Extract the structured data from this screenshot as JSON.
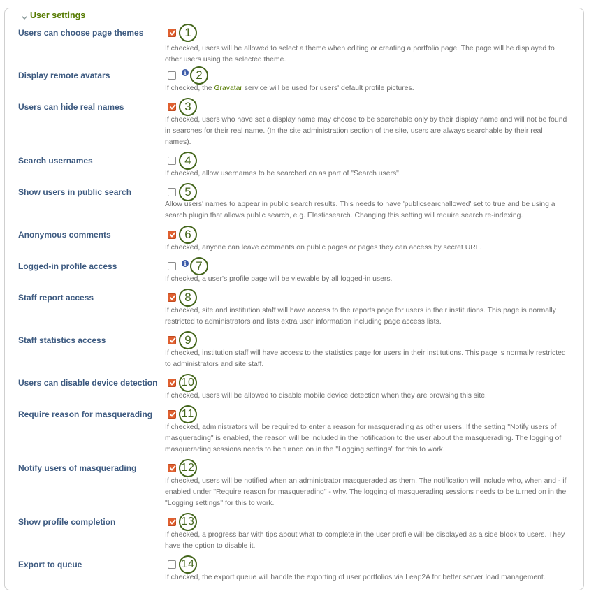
{
  "section": {
    "title": "User settings",
    "collapse_icon": "chevron-down-icon"
  },
  "settings": [
    {
      "label": "Users can choose page themes",
      "checked": true,
      "info": false,
      "callout": "1",
      "description": "If checked, users will be allowed to select a theme when editing or creating a portfolio page. The page will be displayed to other users using the selected theme."
    },
    {
      "label": "Display remote avatars",
      "checked": false,
      "info": true,
      "callout": "2",
      "description_before": "If checked, the ",
      "description_link": "Gravatar",
      "description_after": " service will be used for users' default profile pictures."
    },
    {
      "label": "Users can hide real names",
      "checked": true,
      "info": false,
      "callout": "3",
      "description": "If checked, users who have set a display name may choose to be searchable only by their display name and will not be found in searches for their real name. (In the site administration section of the site, users are always searchable by their real names)."
    },
    {
      "label": "Search usernames",
      "checked": false,
      "info": false,
      "callout": "4",
      "description": "If checked, allow usernames to be searched on as part of \"Search users\"."
    },
    {
      "label": "Show users in public search",
      "checked": false,
      "info": false,
      "callout": "5",
      "description": "Allow users' names to appear in public search results. This needs to have 'publicsearchallowed' set to true and be using a search plugin that allows public search, e.g. Elasticsearch. Changing this setting will require search re-indexing."
    },
    {
      "label": "Anonymous comments",
      "checked": true,
      "info": false,
      "callout": "6",
      "description": "If checked, anyone can leave comments on public pages or pages they can access by secret URL."
    },
    {
      "label": "Logged-in profile access",
      "checked": false,
      "info": true,
      "callout": "7",
      "description": "If checked, a user's profile page will be viewable by all logged-in users."
    },
    {
      "label": "Staff report access",
      "checked": true,
      "info": false,
      "callout": "8",
      "description": "If checked, site and institution staff will have access to the reports page for users in their institutions. This page is normally restricted to administrators and lists extra user information including page access lists."
    },
    {
      "label": "Staff statistics access",
      "checked": true,
      "info": false,
      "callout": "9",
      "description": "If checked, institution staff will have access to the statistics page for users in their institutions. This page is normally restricted to administrators and site staff."
    },
    {
      "label": "Users can disable device detection",
      "checked": true,
      "info": false,
      "callout": "10",
      "description": "If checked, users will be allowed to disable mobile device detection when they are browsing this site."
    },
    {
      "label": "Require reason for masquerading",
      "checked": true,
      "info": false,
      "callout": "11",
      "description": "If checked, administrators will be required to enter a reason for masquerading as other users. If the setting \"Notify users of masquerading\" is enabled, the reason will be included in the notification to the user about the masquerading. The logging of masquerading sessions needs to be turned on in the \"Logging settings\" for this to work."
    },
    {
      "label": "Notify users of masquerading",
      "checked": true,
      "info": false,
      "callout": "12",
      "description": "If checked, users will be notified when an administrator masqueraded as them. The notification will include who, when and - if enabled under \"Require reason for masquerading\" - why. The logging of masquerading sessions needs to be turned on in the \"Logging settings\" for this to work."
    },
    {
      "label": "Show profile completion",
      "checked": true,
      "info": false,
      "callout": "13",
      "description": "If checked, a progress bar with tips about what to complete in the user profile will be displayed as a side block to users. They have the option to disable it."
    },
    {
      "label": "Export to queue",
      "checked": false,
      "info": false,
      "callout": "14",
      "description": "If checked, the export queue will handle the exporting of user portfolios via Leap2A for better server load management."
    }
  ],
  "colors": {
    "label": "#3d5a80",
    "legend": "#557a00",
    "checkbox_checked": "#e06030",
    "callout": "#44661c",
    "info": "#3b5aa8",
    "description": "#6d6d6d"
  }
}
